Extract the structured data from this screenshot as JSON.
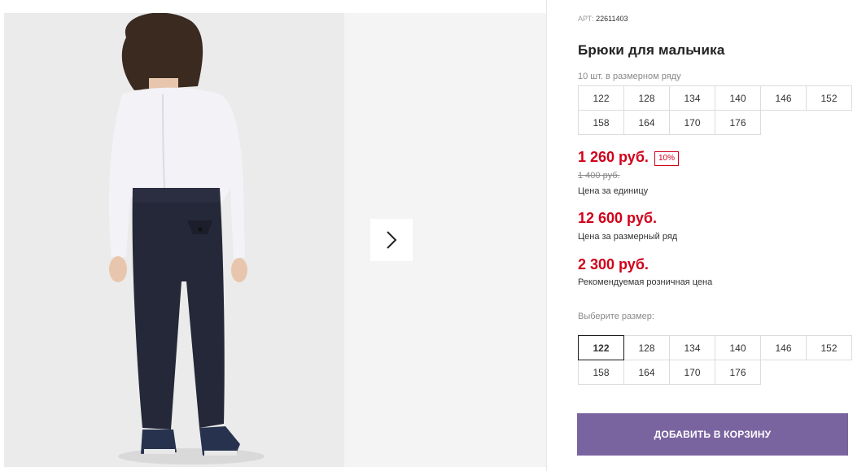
{
  "product": {
    "sku_label": "АРТ:",
    "sku_value": "22611403",
    "title": "Брюки для мальчика",
    "row_count": "10 шт. в размерном ряду"
  },
  "size_row": {
    "sizes": [
      "122",
      "128",
      "134",
      "140",
      "146",
      "152",
      "158",
      "164",
      "170",
      "176"
    ]
  },
  "pricing": {
    "unit_price": "1 260 руб.",
    "discount": "10%",
    "old_price": "1 400 руб.",
    "unit_caption": "Цена за единицу",
    "row_price": "12 600 руб.",
    "row_caption": "Цена за размерный ряд",
    "retail_price": "2 300 руб.",
    "retail_caption": "Рекомендуемая розничная цена"
  },
  "size_chooser": {
    "label": "Выберите размер:",
    "sizes": [
      "122",
      "128",
      "134",
      "140",
      "146",
      "152",
      "158",
      "164",
      "170",
      "176"
    ],
    "selected": "122"
  },
  "cart": {
    "add_label": "ДОБАВИТЬ В КОРЗИНУ",
    "button_color": "#7a64a0"
  },
  "gallery": {
    "next_icon": "chevron-right-icon"
  },
  "colors": {
    "price": "#d0021b",
    "accent": "#7a64a0"
  }
}
